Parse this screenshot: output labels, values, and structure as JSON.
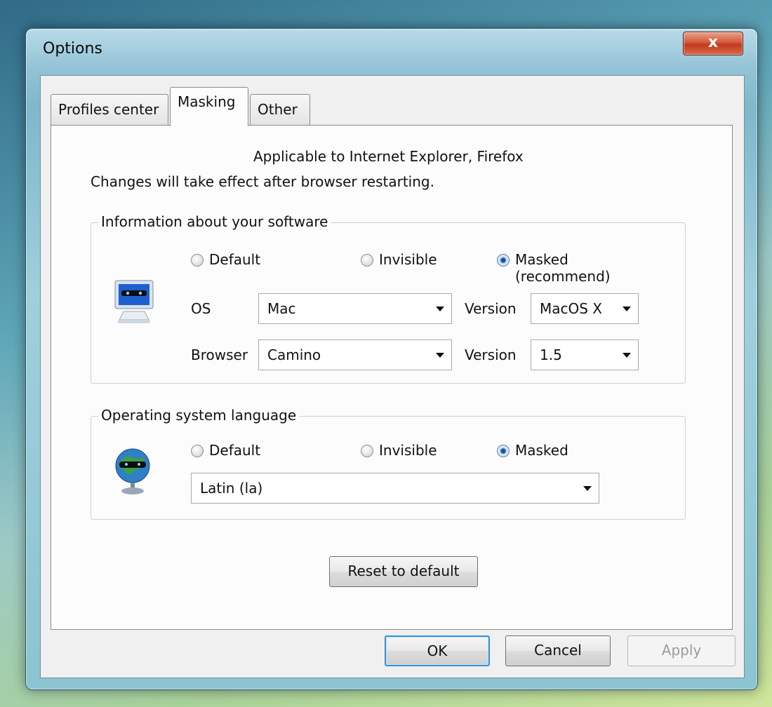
{
  "window": {
    "title": "Options",
    "close_label": "x"
  },
  "tabs": [
    "Profiles center",
    "Masking",
    "Other"
  ],
  "masking": {
    "note1": "Applicable to Internet Explorer, Firefox",
    "note2": "Changes will take effect after browser restarting.",
    "software": {
      "title": "Information about your software",
      "icon": "masked-monitor-icon",
      "options": [
        "Default",
        "Invisible",
        "Masked"
      ],
      "masked_sub": "(recommend)",
      "selected": "Masked",
      "os_label": "OS",
      "os_value": "Mac",
      "os_version_label": "Version",
      "os_version_value": "MacOS X",
      "browser_label": "Browser",
      "browser_value": "Camino",
      "browser_version_label": "Version",
      "browser_version_value": "1.5"
    },
    "language": {
      "title": "Operating system language",
      "icon": "masked-globe-icon",
      "options": [
        "Default",
        "Invisible",
        "Masked"
      ],
      "selected": "Masked",
      "value": "Latin (la)"
    },
    "reset_label": "Reset to default"
  },
  "footer": {
    "ok": "OK",
    "cancel": "Cancel",
    "apply": "Apply"
  },
  "colors": {
    "desktop": "#5fa7b9",
    "focus_border": "#3a91d2",
    "close_red": "#c03a1e"
  }
}
